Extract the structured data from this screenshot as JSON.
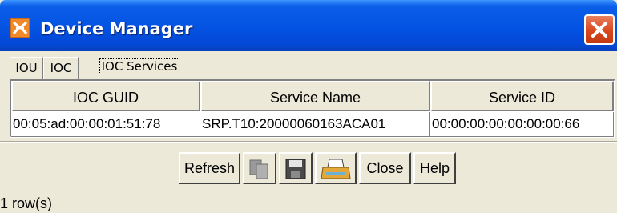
{
  "window": {
    "title": "Device Manager",
    "icon": "device-manager-icon",
    "close_icon": "close-icon"
  },
  "tabs": [
    {
      "label": "IOU",
      "active": false
    },
    {
      "label": "IOC",
      "active": false
    },
    {
      "label": "IOC Services",
      "active": true
    }
  ],
  "table": {
    "columns": [
      "IOC GUID",
      "Service Name",
      "Service ID"
    ],
    "rows": [
      [
        "00:05:ad:00:00:01:51:78",
        "SRP.T10:20000060163ACA01",
        "00:00:00:00:00:00:00:66"
      ]
    ]
  },
  "toolbar": {
    "refresh_label": "Refresh",
    "copy_icon": "copy-icon",
    "save_icon": "save-icon",
    "print_icon": "print-icon",
    "close_label": "Close",
    "help_label": "Help"
  },
  "status": "1 row(s)",
  "colors": {
    "titlebar": "#0554e3",
    "close_button": "#d9481d",
    "dialog_background": "#ece9d8"
  }
}
